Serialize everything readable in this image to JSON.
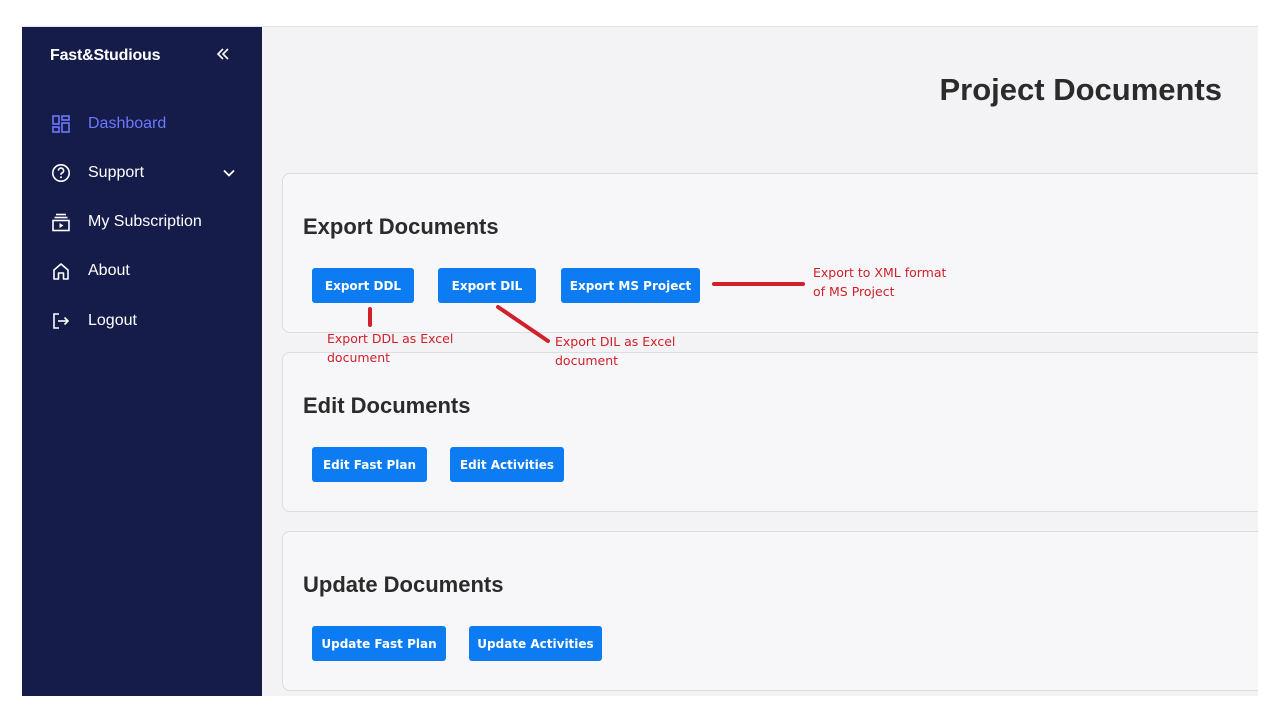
{
  "sidebar": {
    "brand": "Fast&Studious",
    "collapse_icon": "double-chevron-left-icon",
    "items": [
      {
        "label": "Dashboard",
        "icon": "dashboard-grid-icon",
        "active": true
      },
      {
        "label": "Support",
        "icon": "help-circle-icon",
        "has_submenu": true
      },
      {
        "label": "My Subscription",
        "icon": "subscription-play-icon"
      },
      {
        "label": "About",
        "icon": "home-icon"
      },
      {
        "label": "Logout",
        "icon": "logout-icon"
      }
    ]
  },
  "main": {
    "title": "Project Documents",
    "sections": [
      {
        "title": "Export Documents",
        "buttons": [
          "Export DDL",
          "Export DIL",
          "Export MS Project"
        ]
      },
      {
        "title": "Edit Documents",
        "buttons": [
          "Edit Fast Plan",
          "Edit Activities"
        ]
      },
      {
        "title": "Update Documents",
        "buttons": [
          "Update Fast Plan",
          "Update Activities"
        ]
      }
    ]
  },
  "annotations": {
    "ms_project": "Export to XML format\nof MS Project",
    "ddl": "Export DDL as Excel\ndocument",
    "dil": "Export DIL as Excel\ndocument"
  },
  "colors": {
    "sidebar_bg": "#151c4a",
    "active_nav": "#6b78ff",
    "button_bg": "#0d7cf2",
    "annotation": "#d0202a"
  }
}
